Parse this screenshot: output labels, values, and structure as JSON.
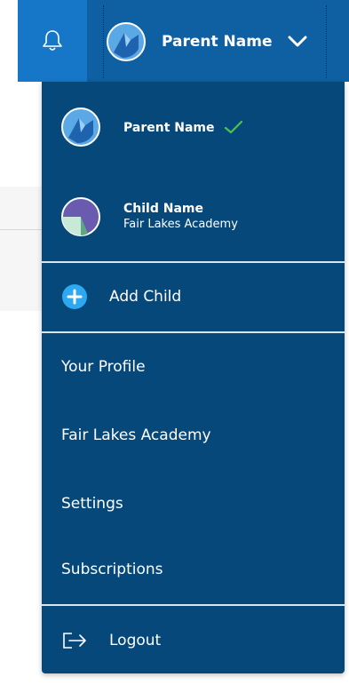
{
  "header": {
    "user_name": "Parent Name",
    "icons": {
      "bell": "bell-icon",
      "chevron": "chevron-down-icon"
    }
  },
  "menu": {
    "accounts": [
      {
        "name": "Parent Name",
        "subtitle": "",
        "selected": true
      },
      {
        "name": "Child Name",
        "subtitle": "Fair Lakes Academy",
        "selected": false
      }
    ],
    "add_child": "Add Child",
    "links": [
      "Your Profile",
      "Fair Lakes Academy",
      "Settings",
      "Subscriptions"
    ],
    "logout": "Logout"
  },
  "colors": {
    "topbar": "#0f5fa3",
    "bell_button": "#1677c8",
    "menu_bg": "#07487a",
    "check": "#4fc24f",
    "add_icon": "#2ea8f0"
  }
}
